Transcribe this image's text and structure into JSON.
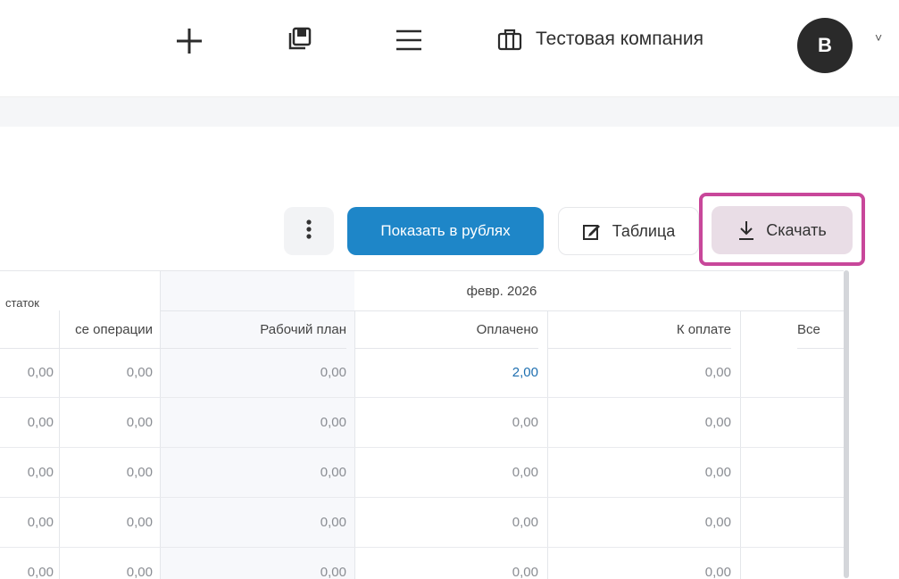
{
  "header": {
    "icons": [
      "plus-icon",
      "pages-icon",
      "menu-icon",
      "briefcase-icon"
    ],
    "company_name": "Тестовая компания",
    "avatar_letter": "В",
    "chevron": "˅"
  },
  "toolbar": {
    "more_label": "⋮",
    "show_rubles_label": "Показать в рублях",
    "table_label": "Таблица",
    "download_label": "Скачать",
    "primary_color": "#1e86c8",
    "highlight_color": "#c8479a"
  },
  "table": {
    "top_headers": {
      "balance": "статок",
      "period": "февр. 2026"
    },
    "columns": [
      "се операции",
      "Рабочий план",
      "Оплачено",
      "К оплате",
      "Все"
    ],
    "rows": [
      [
        "0,00",
        "0,00",
        "0,00",
        "2,00",
        "0,00"
      ],
      [
        "0,00",
        "0,00",
        "0,00",
        "0,00",
        "0,00"
      ],
      [
        "0,00",
        "0,00",
        "0,00",
        "0,00",
        "0,00"
      ],
      [
        "0,00",
        "0,00",
        "0,00",
        "0,00",
        "0,00"
      ],
      [
        "0,00",
        "0,00",
        "0,00",
        "0,00",
        "0,00"
      ]
    ]
  }
}
